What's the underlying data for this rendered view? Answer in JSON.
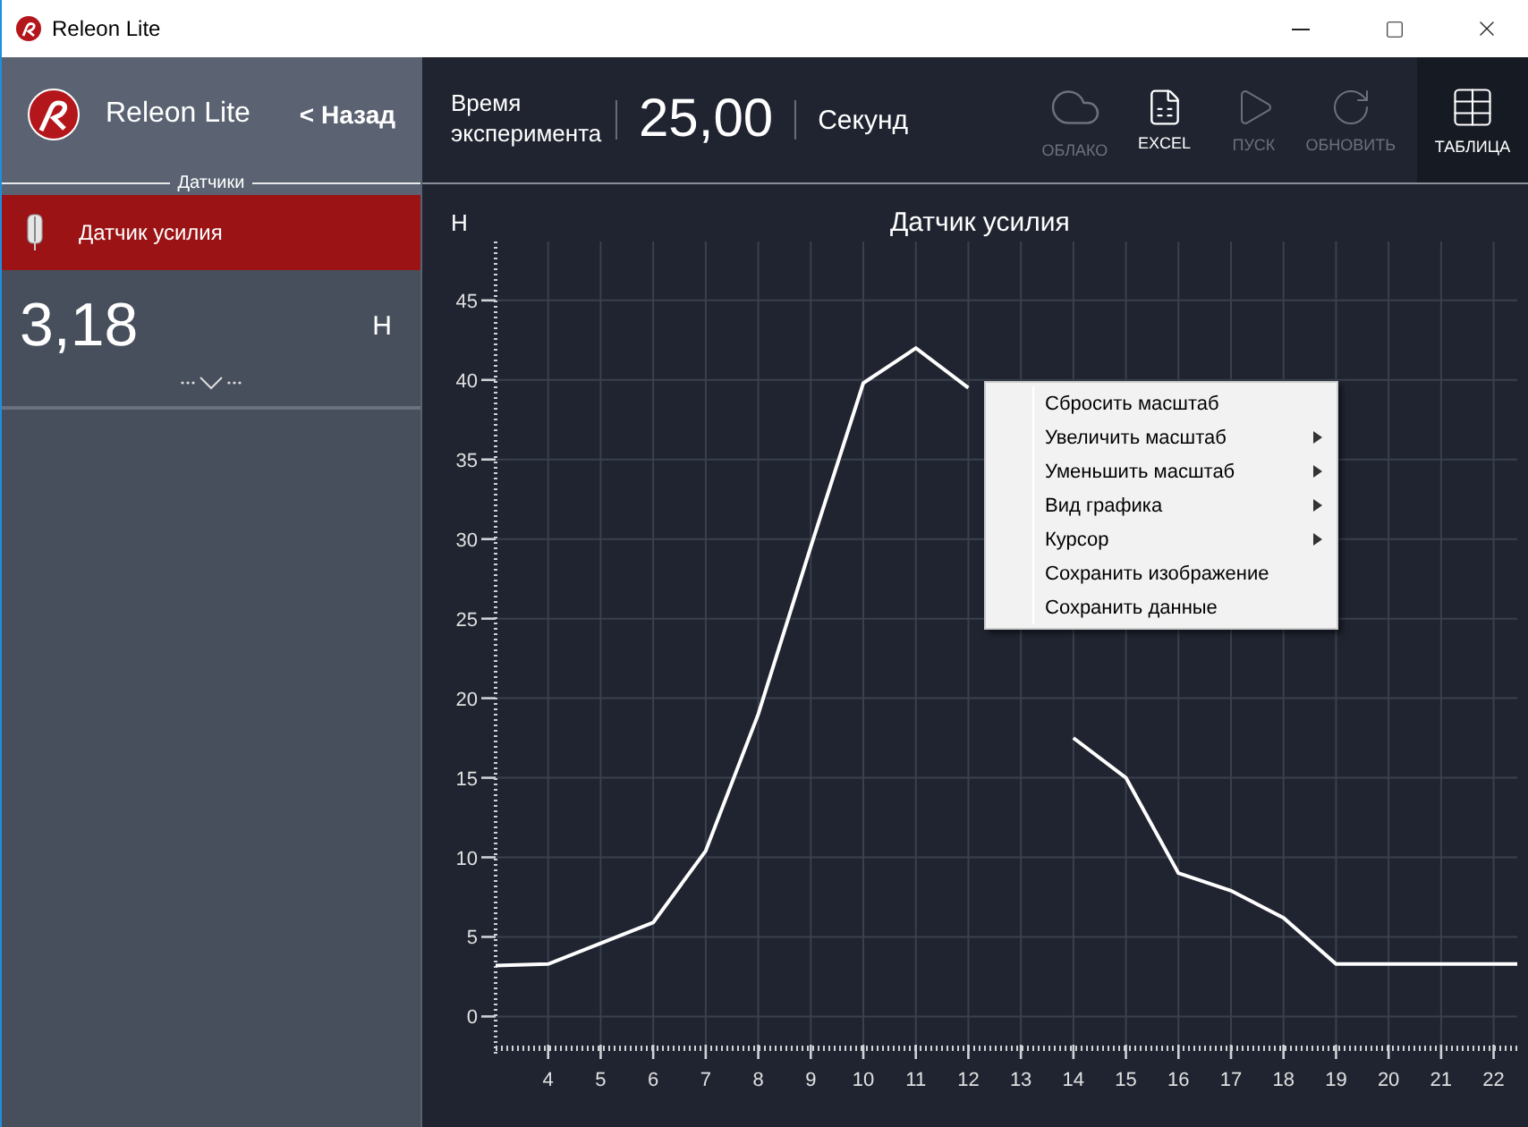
{
  "window": {
    "title": "Releon Lite"
  },
  "sidebar": {
    "app_name": "Releon Lite",
    "back": "< Назад",
    "section": "Датчики",
    "sensors": [
      {
        "name": "Датчик усилия",
        "selected": true,
        "value": "3,18",
        "unit": "Н"
      }
    ]
  },
  "toolbar": {
    "time_label": "Время эксперимента",
    "time_value": "25,00",
    "time_unit": "Секунд",
    "buttons": [
      {
        "label": "ОБЛАКО",
        "kind": "cloud",
        "disabled": true,
        "selected": false
      },
      {
        "label": "EXCEL",
        "kind": "excel",
        "disabled": false,
        "selected": false
      },
      {
        "label": "ПУСК",
        "kind": "play",
        "disabled": true,
        "selected": false
      },
      {
        "label": "ОБНОВИТЬ",
        "kind": "refresh",
        "disabled": true,
        "selected": false
      },
      {
        "label": "ТАБЛИЦА",
        "kind": "table",
        "disabled": false,
        "selected": true
      }
    ]
  },
  "chart": {
    "chart_data": {
      "type": "line",
      "title": "Датчик усилия",
      "ylabel": "Н",
      "x": [
        3,
        4,
        5,
        6,
        7,
        8,
        9,
        10,
        11,
        12,
        13,
        14,
        15,
        16,
        17,
        18,
        19,
        20,
        21,
        22,
        22.45
      ],
      "series": [
        {
          "color": "#ffffff",
          "values": [
            3.2,
            3.3,
            4.6,
            5.9,
            10.4,
            19,
            29.5,
            39.8,
            42,
            39.5,
            null,
            17.5,
            15,
            9,
            7.9,
            6.2,
            3.3,
            3.3,
            3.3,
            3.3,
            3.3
          ]
        }
      ],
      "grid": true,
      "xlim": [
        3,
        22.45
      ],
      "ylim": [
        -2,
        48.7
      ],
      "xticks": [
        4,
        5,
        6,
        7,
        8,
        9,
        10,
        11,
        12,
        13,
        14,
        15,
        16,
        17,
        18,
        19,
        20,
        21,
        22
      ],
      "yticks": [
        0,
        5,
        10,
        15,
        20,
        25,
        30,
        35,
        40,
        45
      ]
    }
  },
  "context_menu": {
    "items": [
      {
        "label": "Сбросить масштаб",
        "submenu": false
      },
      {
        "label": "Увеличить масштаб",
        "submenu": true
      },
      {
        "label": "Уменьшить масштаб",
        "submenu": true
      },
      {
        "label": "Вид графика",
        "submenu": true
      },
      {
        "label": "Курсор",
        "submenu": true
      },
      {
        "label": "Сохранить изображение",
        "submenu": false
      },
      {
        "label": "Сохранить данные",
        "submenu": false
      }
    ]
  }
}
